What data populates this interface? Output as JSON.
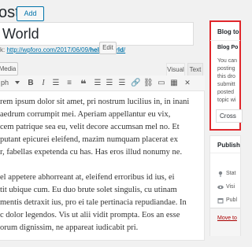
{
  "header": {
    "page_title": "ost",
    "add_new_label": "Add New"
  },
  "post": {
    "title": "World",
    "permalink_prefix": "k: ",
    "permalink_url_base": "http://wpforo.com/2017/06/09/",
    "permalink_slug": "hello-world",
    "permalink_suffix": "/",
    "edit_label": "Edit"
  },
  "editor": {
    "media_label": "Media",
    "tab_visual": "Visual",
    "tab_text": "Text",
    "format_select": "ph",
    "toolbar": [
      {
        "name": "bold-button",
        "glyph": "B"
      },
      {
        "name": "italic-button",
        "glyph": "I"
      },
      {
        "name": "bulleted-list-button",
        "glyph": "☰"
      },
      {
        "name": "numbered-list-button",
        "glyph": "≡"
      },
      {
        "name": "blockquote-button",
        "glyph": "❝"
      },
      {
        "name": "align-left-button",
        "glyph": "☰"
      },
      {
        "name": "align-center-button",
        "glyph": "☰"
      },
      {
        "name": "align-right-button",
        "glyph": "☰"
      },
      {
        "name": "insert-link-button",
        "glyph": "🔗"
      },
      {
        "name": "remove-link-button",
        "glyph": "⛓"
      },
      {
        "name": "read-more-button",
        "glyph": "▭"
      },
      {
        "name": "toolbar-toggle-button",
        "glyph": "▦"
      },
      {
        "name": "fullscreen-button",
        "glyph": "✕"
      }
    ],
    "paragraphs": [
      [
        "rem ipsum dolor sit amet, pri nostrum lucilius in, in inani",
        "aedrum corrumpit mei. Aperiam appellantur eu vix,",
        "cem patrique sea eu, velit decore accumsan mel no. Et",
        "putant epicurei eleifend, mazim numquam placerat ex",
        "r, fabellas expetenda cu has. Has eros illud nonumy ne."
      ],
      [
        "el appetere abhorreant at, eleifend erroribus id ius, ei",
        "tit ubique cum. Eu duo brute solet singulis, cu utinam",
        "mentis detraxit ius, pro ei tale pertinacia repudiandae. In",
        "c dolor legendos. Vis ut alii vidit prompta. Eos an esse",
        "orum dignissim, ne appareat iudicabit pri."
      ]
    ]
  },
  "sidebar": {
    "blog_box": {
      "title": "Blog to",
      "label": "Blog Po",
      "description_lines": [
        "You can",
        "posting",
        "this dro",
        "submitt",
        "posted",
        "topic wi"
      ],
      "select_value": "Cross"
    },
    "publish_box": {
      "title": "Publish",
      "rows": [
        {
          "icon": "pin-icon",
          "label": "Stat"
        },
        {
          "icon": "eye-icon",
          "label": "Visi"
        },
        {
          "icon": "calendar-icon",
          "label": "Publ"
        }
      ],
      "trash_label": "Move to"
    }
  }
}
